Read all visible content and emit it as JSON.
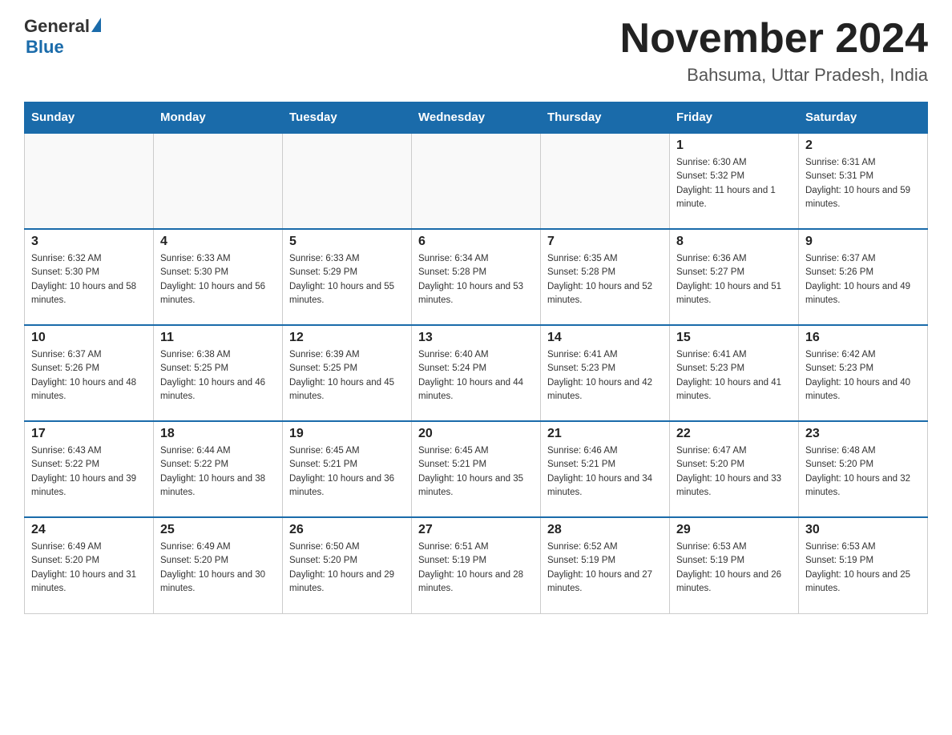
{
  "header": {
    "logo_general": "General",
    "logo_blue": "Blue",
    "month_title": "November 2024",
    "location": "Bahsuma, Uttar Pradesh, India"
  },
  "days_of_week": [
    "Sunday",
    "Monday",
    "Tuesday",
    "Wednesday",
    "Thursday",
    "Friday",
    "Saturday"
  ],
  "weeks": [
    [
      {
        "day": "",
        "info": ""
      },
      {
        "day": "",
        "info": ""
      },
      {
        "day": "",
        "info": ""
      },
      {
        "day": "",
        "info": ""
      },
      {
        "day": "",
        "info": ""
      },
      {
        "day": "1",
        "info": "Sunrise: 6:30 AM\nSunset: 5:32 PM\nDaylight: 11 hours and 1 minute."
      },
      {
        "day": "2",
        "info": "Sunrise: 6:31 AM\nSunset: 5:31 PM\nDaylight: 10 hours and 59 minutes."
      }
    ],
    [
      {
        "day": "3",
        "info": "Sunrise: 6:32 AM\nSunset: 5:30 PM\nDaylight: 10 hours and 58 minutes."
      },
      {
        "day": "4",
        "info": "Sunrise: 6:33 AM\nSunset: 5:30 PM\nDaylight: 10 hours and 56 minutes."
      },
      {
        "day": "5",
        "info": "Sunrise: 6:33 AM\nSunset: 5:29 PM\nDaylight: 10 hours and 55 minutes."
      },
      {
        "day": "6",
        "info": "Sunrise: 6:34 AM\nSunset: 5:28 PM\nDaylight: 10 hours and 53 minutes."
      },
      {
        "day": "7",
        "info": "Sunrise: 6:35 AM\nSunset: 5:28 PM\nDaylight: 10 hours and 52 minutes."
      },
      {
        "day": "8",
        "info": "Sunrise: 6:36 AM\nSunset: 5:27 PM\nDaylight: 10 hours and 51 minutes."
      },
      {
        "day": "9",
        "info": "Sunrise: 6:37 AM\nSunset: 5:26 PM\nDaylight: 10 hours and 49 minutes."
      }
    ],
    [
      {
        "day": "10",
        "info": "Sunrise: 6:37 AM\nSunset: 5:26 PM\nDaylight: 10 hours and 48 minutes."
      },
      {
        "day": "11",
        "info": "Sunrise: 6:38 AM\nSunset: 5:25 PM\nDaylight: 10 hours and 46 minutes."
      },
      {
        "day": "12",
        "info": "Sunrise: 6:39 AM\nSunset: 5:25 PM\nDaylight: 10 hours and 45 minutes."
      },
      {
        "day": "13",
        "info": "Sunrise: 6:40 AM\nSunset: 5:24 PM\nDaylight: 10 hours and 44 minutes."
      },
      {
        "day": "14",
        "info": "Sunrise: 6:41 AM\nSunset: 5:23 PM\nDaylight: 10 hours and 42 minutes."
      },
      {
        "day": "15",
        "info": "Sunrise: 6:41 AM\nSunset: 5:23 PM\nDaylight: 10 hours and 41 minutes."
      },
      {
        "day": "16",
        "info": "Sunrise: 6:42 AM\nSunset: 5:23 PM\nDaylight: 10 hours and 40 minutes."
      }
    ],
    [
      {
        "day": "17",
        "info": "Sunrise: 6:43 AM\nSunset: 5:22 PM\nDaylight: 10 hours and 39 minutes."
      },
      {
        "day": "18",
        "info": "Sunrise: 6:44 AM\nSunset: 5:22 PM\nDaylight: 10 hours and 38 minutes."
      },
      {
        "day": "19",
        "info": "Sunrise: 6:45 AM\nSunset: 5:21 PM\nDaylight: 10 hours and 36 minutes."
      },
      {
        "day": "20",
        "info": "Sunrise: 6:45 AM\nSunset: 5:21 PM\nDaylight: 10 hours and 35 minutes."
      },
      {
        "day": "21",
        "info": "Sunrise: 6:46 AM\nSunset: 5:21 PM\nDaylight: 10 hours and 34 minutes."
      },
      {
        "day": "22",
        "info": "Sunrise: 6:47 AM\nSunset: 5:20 PM\nDaylight: 10 hours and 33 minutes."
      },
      {
        "day": "23",
        "info": "Sunrise: 6:48 AM\nSunset: 5:20 PM\nDaylight: 10 hours and 32 minutes."
      }
    ],
    [
      {
        "day": "24",
        "info": "Sunrise: 6:49 AM\nSunset: 5:20 PM\nDaylight: 10 hours and 31 minutes."
      },
      {
        "day": "25",
        "info": "Sunrise: 6:49 AM\nSunset: 5:20 PM\nDaylight: 10 hours and 30 minutes."
      },
      {
        "day": "26",
        "info": "Sunrise: 6:50 AM\nSunset: 5:20 PM\nDaylight: 10 hours and 29 minutes."
      },
      {
        "day": "27",
        "info": "Sunrise: 6:51 AM\nSunset: 5:19 PM\nDaylight: 10 hours and 28 minutes."
      },
      {
        "day": "28",
        "info": "Sunrise: 6:52 AM\nSunset: 5:19 PM\nDaylight: 10 hours and 27 minutes."
      },
      {
        "day": "29",
        "info": "Sunrise: 6:53 AM\nSunset: 5:19 PM\nDaylight: 10 hours and 26 minutes."
      },
      {
        "day": "30",
        "info": "Sunrise: 6:53 AM\nSunset: 5:19 PM\nDaylight: 10 hours and 25 minutes."
      }
    ]
  ]
}
